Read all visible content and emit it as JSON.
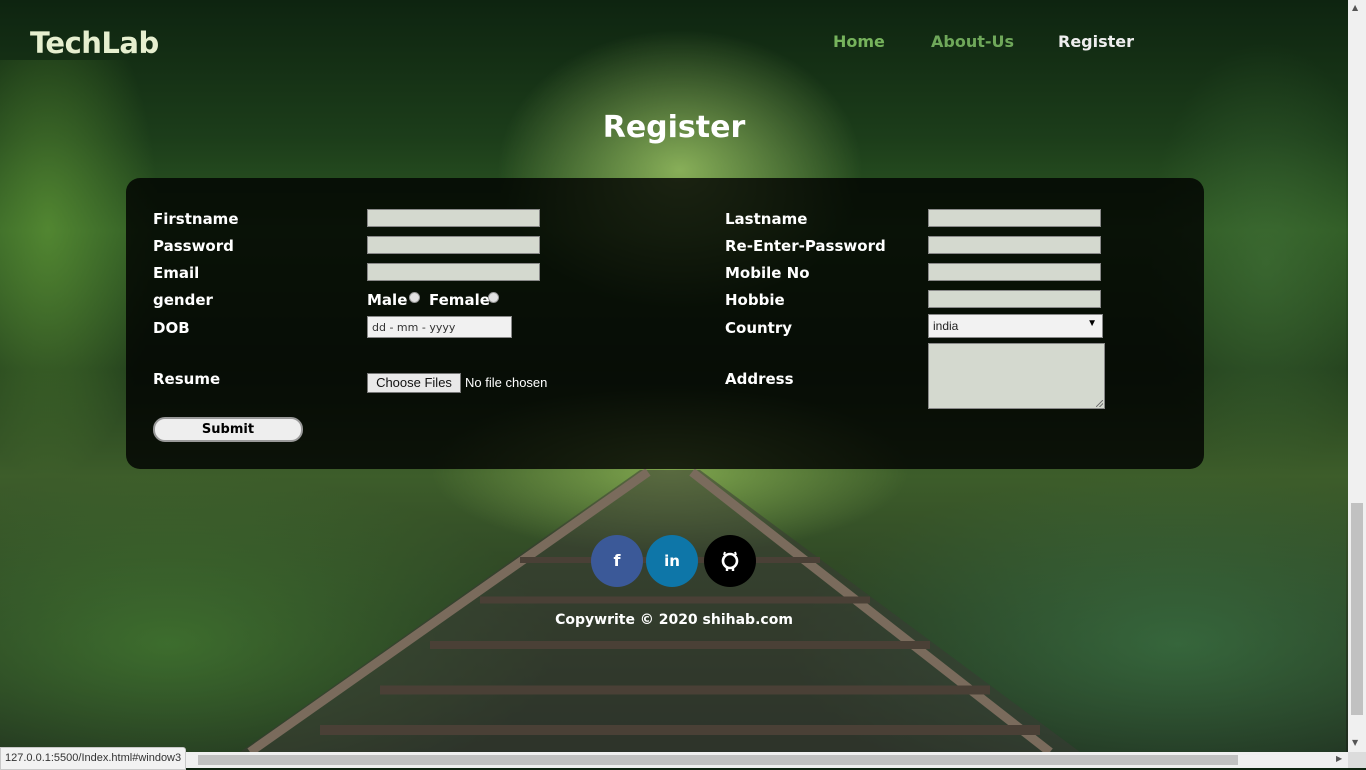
{
  "navbar": {
    "brand": "TechLab",
    "links": [
      {
        "label": "Home"
      },
      {
        "label": "About-Us"
      },
      {
        "label": "Register"
      }
    ]
  },
  "page": {
    "title": "Register"
  },
  "form": {
    "left": {
      "firstname_label": "Firstname",
      "password_label": "Password",
      "email_label": "Email",
      "gender_label": "gender",
      "dob_label": "DOB",
      "resume_label": "Resume"
    },
    "right": {
      "lastname_label": "Lastname",
      "reenter_password_label": "Re-Enter-Password",
      "mobile_label": "Mobile No",
      "hobbie_label": "Hobbie",
      "country_label": "Country",
      "address_label": "Address"
    },
    "gender_options": [
      "Male",
      "Female"
    ],
    "dob_placeholder": "dd - mm - yyyy",
    "file_button_label": "Choose Files",
    "file_status": "No file chosen",
    "country_selected": "india",
    "submit_label": "Submit"
  },
  "social": {
    "facebook_glyph": "f",
    "linkedin_glyph": "in",
    "github_glyph": "github-icon"
  },
  "footer": {
    "copyright": "Copywrite © 2020 shihab.com"
  },
  "browser": {
    "status_url": "127.0.0.1:5500/Index.html#window3"
  }
}
